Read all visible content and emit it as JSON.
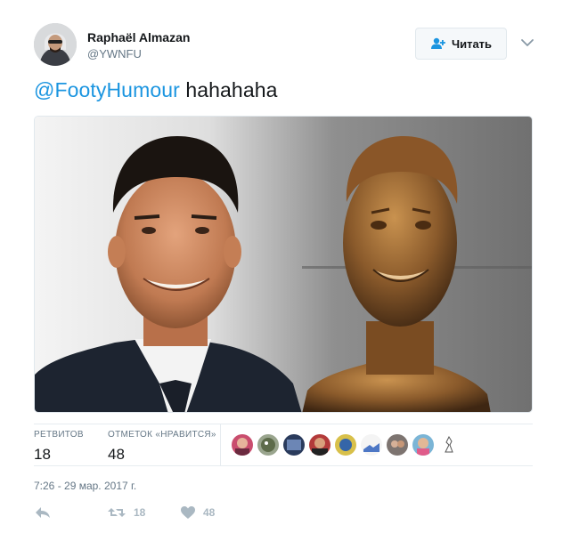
{
  "author": {
    "name": "Raphaël Almazan",
    "handle": "@YWNFU"
  },
  "follow_button": {
    "label": "Читать",
    "icon": "add-user-icon"
  },
  "tweet": {
    "mention": "@FootyHumour",
    "text": " hahahaha"
  },
  "media": {
    "description_icon": "photo"
  },
  "stats": {
    "retweets_label": "РЕТВИТОВ",
    "retweets_value": "18",
    "likes_label": "ОТМЕТОК «НРАВИТСЯ»",
    "likes_value": "48"
  },
  "likers_count": 9,
  "timestamp": "7:26 - 29 мар. 2017 г.",
  "actions": {
    "reply_icon": "reply-icon",
    "retweet_icon": "retweet-icon",
    "retweet_count": "18",
    "like_icon": "heart-icon",
    "like_count": "48"
  },
  "colors": {
    "link": "#1b95e0",
    "muted": "#657786",
    "action": "#aab8c2",
    "border": "#e6ecf0"
  }
}
